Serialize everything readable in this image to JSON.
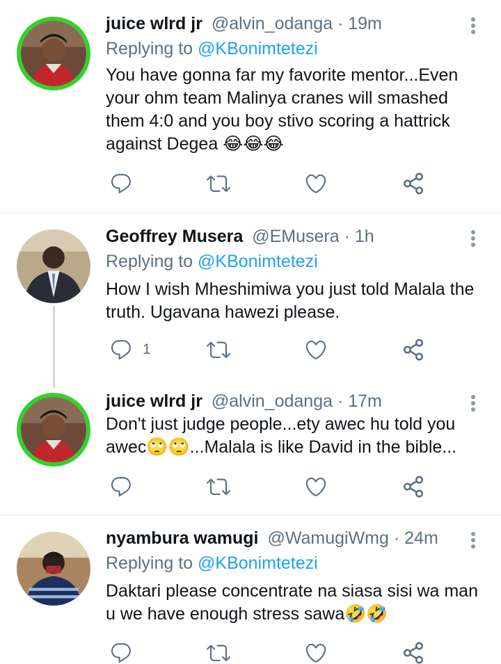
{
  "tweets": [
    {
      "name": "juice wlrd jr",
      "handle": "@alvin_odanga",
      "time": "· 19m",
      "replying_prefix": "Replying to",
      "replying_to": "@KBonimtetezi",
      "text": "You have gonna far my favorite mentor...Even\nyour ohm team Malinya cranes will smashed\nthem 4:0 and you boy stivo scoring a hattrick\nagainst Degea 😂😂😂",
      "reply_count": ""
    },
    {
      "name": "Geoffrey  Musera",
      "handle": "@EMusera",
      "time": "· 1h",
      "replying_prefix": "Replying to",
      "replying_to": "@KBonimtetezi",
      "text": "How I wish Mheshimiwa you just told Malala the\ntruth. Ugavana hawezi please.",
      "reply_count": "1"
    },
    {
      "name": "juice wlrd jr",
      "handle": "@alvin_odanga",
      "time": "· 17m",
      "text": "Don't just judge people...ety awec hu told you\nawec🙄🙄...Malala is like David in the bible...",
      "reply_count": ""
    },
    {
      "name": "nyambura wamugi",
      "handle": "@WamugiWmg",
      "time": "· 24m",
      "replying_prefix": "Replying to",
      "replying_to": "@KBonimtetezi",
      "text": "Daktari please concentrate na siasa sisi wa man\nu we have enough stress sawa🤣🤣",
      "reply_count": ""
    }
  ],
  "icons": {
    "reply": "reply-icon",
    "retweet": "retweet-icon",
    "like": "heart-icon",
    "share": "share-icon",
    "more": "more-vertical-icon"
  },
  "colors": {
    "text": "#0f1419",
    "secondary": "#5b7083",
    "link": "#1da1f2",
    "story_ring": "#34d12c",
    "divider": "#e1e8ed"
  }
}
